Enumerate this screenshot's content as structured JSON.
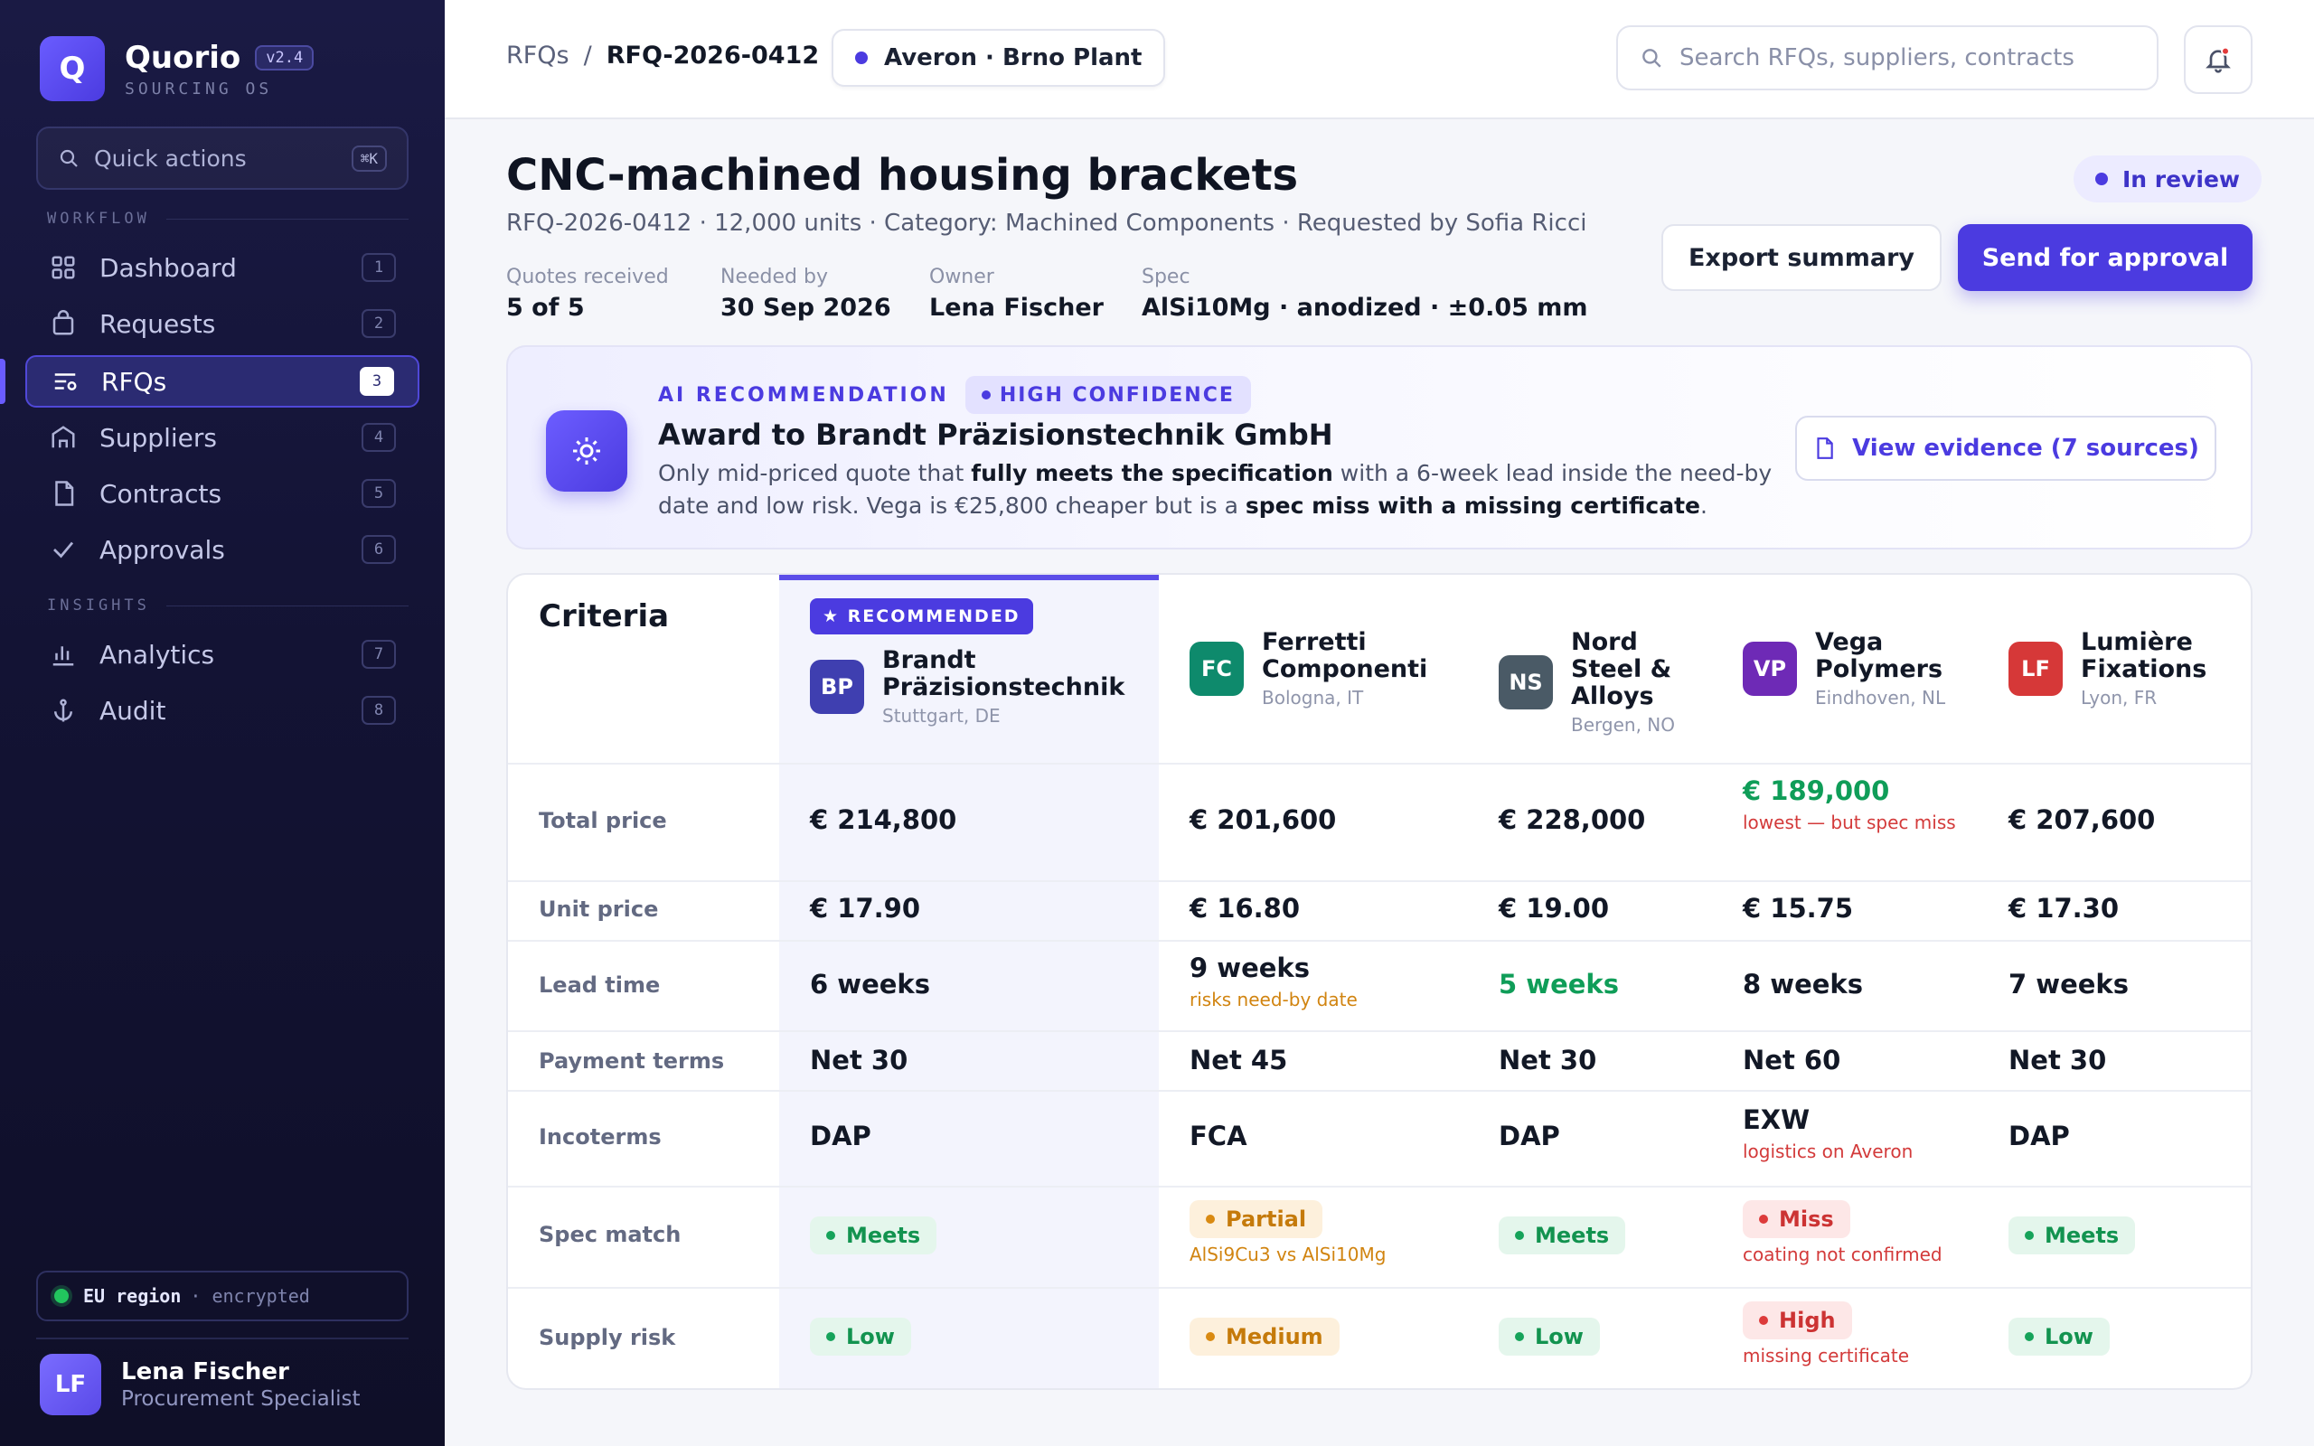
{
  "brand": {
    "logo_letter": "Q",
    "name": "Quorio",
    "version": "v2.4",
    "subtitle": "SOURCING OS"
  },
  "quick_actions": {
    "label": "Quick actions",
    "shortcut": "⌘K"
  },
  "sidebar": {
    "section_workflow": "WORKFLOW",
    "section_insights": "INSIGHTS",
    "items": [
      {
        "label": "Dashboard",
        "num": "1",
        "icon": "grid-icon"
      },
      {
        "label": "Requests",
        "num": "2",
        "icon": "bag-icon"
      },
      {
        "label": "RFQs",
        "num": "3",
        "icon": "list-icon",
        "active": true
      },
      {
        "label": "Suppliers",
        "num": "4",
        "icon": "building-icon"
      },
      {
        "label": "Contracts",
        "num": "5",
        "icon": "document-icon"
      },
      {
        "label": "Approvals",
        "num": "6",
        "icon": "check-icon"
      },
      {
        "label": "Analytics",
        "num": "7",
        "icon": "bar-chart-icon"
      },
      {
        "label": "Audit",
        "num": "8",
        "icon": "anchor-icon"
      }
    ],
    "region": {
      "label": "EU region",
      "suffix": "· encrypted"
    },
    "user": {
      "initials": "LF",
      "name": "Lena Fischer",
      "role": "Procurement Specialist"
    }
  },
  "topbar": {
    "breadcrumb_root": "RFQs",
    "breadcrumb_sep": "/",
    "breadcrumb_current": "RFQ-2026-0412",
    "plant": "Averon · Brno Plant",
    "search_placeholder": "Search RFQs, suppliers, contracts"
  },
  "header": {
    "title": "CNC-machined housing brackets",
    "subtitle": "RFQ-2026-0412 · 12,000 units · Category: Machined Components · Requested by Sofia Ricci",
    "status": "In review",
    "meta": [
      {
        "label": "Quotes received",
        "value": "5 of 5"
      },
      {
        "label": "Needed by",
        "value": "30 Sep 2026"
      },
      {
        "label": "Owner",
        "value": "Lena Fischer"
      },
      {
        "label": "Spec",
        "value": "AlSi10Mg · anodized · ±0.05 mm"
      }
    ],
    "export_label": "Export summary",
    "send_label": "Send for approval"
  },
  "ai": {
    "tag": "AI RECOMMENDATION",
    "confidence": "HIGH CONFIDENCE",
    "title": "Award to Brandt Präzisionstechnik GmbH",
    "body_1": "Only mid-priced quote that ",
    "body_b1": "fully meets the specification",
    "body_2": " with a 6-week lead inside the need-by date and low risk. Vega is €25,800 cheaper but is a ",
    "body_b2": "spec miss with a missing certificate",
    "body_3": ".",
    "evidence_label": "View evidence (7 sources)"
  },
  "table": {
    "criteria_label": "Criteria",
    "recommended_label": "★ RECOMMENDED",
    "row_labels": [
      "Total price",
      "Unit price",
      "Lead time",
      "Payment terms",
      "Incoterms",
      "Spec match",
      "Supply risk"
    ],
    "suppliers": [
      {
        "initials": "BP",
        "color": "#3f3fb0",
        "name_1": "Brandt",
        "name_2": "Präzisionstechnik",
        "name_3": "",
        "location": "Stuttgart, DE",
        "total": "€ 214,800",
        "total_note": "",
        "unit": "€ 17.90",
        "lead": "6 weeks",
        "lead_note": "",
        "payment": "Net 30",
        "incoterm": "DAP",
        "incoterm_note": "",
        "spec": "Meets",
        "spec_note": "",
        "risk": "Low",
        "risk_note": ""
      },
      {
        "initials": "FC",
        "color": "#0e8a6c",
        "name_1": "Ferretti",
        "name_2": "Componenti",
        "name_3": "",
        "location": "Bologna, IT",
        "total": "€ 201,600",
        "total_note": "",
        "unit": "€ 16.80",
        "lead": "9 weeks",
        "lead_note": "risks need-by date",
        "payment": "Net 45",
        "incoterm": "FCA",
        "incoterm_note": "",
        "spec": "Partial",
        "spec_note": "AlSi9Cu3 vs AlSi10Mg",
        "risk": "Medium",
        "risk_note": ""
      },
      {
        "initials": "NS",
        "color": "#4a5a66",
        "name_1": "Nord",
        "name_2": "Steel &",
        "name_3": "Alloys",
        "location": "Bergen, NO",
        "total": "€ 228,000",
        "total_note": "",
        "unit": "€ 19.00",
        "lead": "5 weeks",
        "lead_note": "",
        "payment": "Net 30",
        "incoterm": "DAP",
        "incoterm_note": "",
        "spec": "Meets",
        "spec_note": "",
        "risk": "Low",
        "risk_note": ""
      },
      {
        "initials": "VP",
        "color": "#6e2ab6",
        "name_1": "Vega",
        "name_2": "Polymers",
        "name_3": "",
        "location": "Eindhoven, NL",
        "total": "€ 189,000",
        "total_note": "lowest — but spec miss",
        "unit": "€ 15.75",
        "lead": "8 weeks",
        "lead_note": "",
        "payment": "Net 60",
        "incoterm": "EXW",
        "incoterm_note": "logistics on Averon",
        "spec": "Miss",
        "spec_note": "coating not confirmed",
        "risk": "High",
        "risk_note": "missing certificate"
      },
      {
        "initials": "LF",
        "color": "#d63838",
        "name_1": "Lumière",
        "name_2": "Fixations",
        "name_3": "",
        "location": "Lyon, FR",
        "total": "€ 207,600",
        "total_note": "",
        "unit": "€ 17.30",
        "lead": "7 weeks",
        "lead_note": "",
        "payment": "Net 30",
        "incoterm": "DAP",
        "incoterm_note": "",
        "spec": "Meets",
        "spec_note": "",
        "risk": "Low",
        "risk_note": ""
      }
    ]
  }
}
